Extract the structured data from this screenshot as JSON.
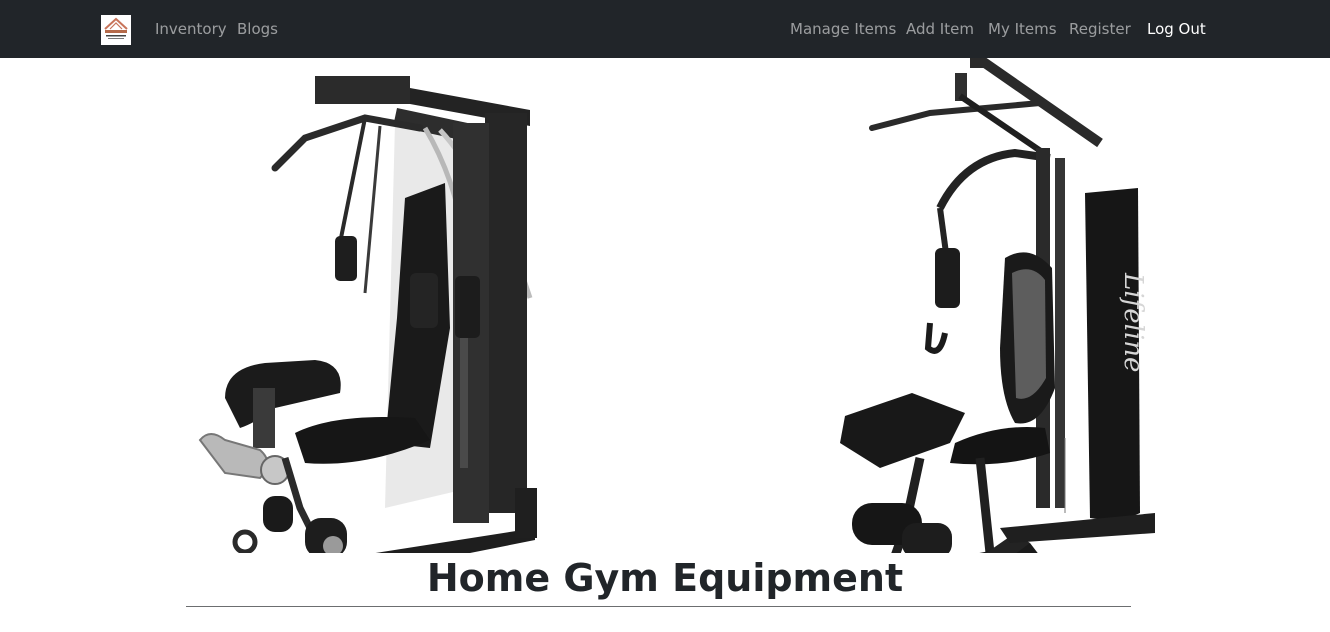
{
  "navbar": {
    "logo_icon": "fitness-pro-logo",
    "left_links": [
      {
        "label": "Inventory"
      },
      {
        "label": "Blogs"
      }
    ],
    "right_links": [
      {
        "label": "Manage Items"
      },
      {
        "label": "Add Item"
      },
      {
        "label": "My Items"
      },
      {
        "label": "Register"
      },
      {
        "label": "Log Out"
      }
    ],
    "background": "#212529",
    "link_color": "rgba(255,255,255,0.55)",
    "active_link_color": "#ffffff"
  },
  "hero": {
    "images": [
      {
        "icon": "gym-machine-icon"
      },
      {
        "icon": "home-gym-station-icon"
      }
    ]
  },
  "section": {
    "title": "Home Gym Equipment"
  }
}
